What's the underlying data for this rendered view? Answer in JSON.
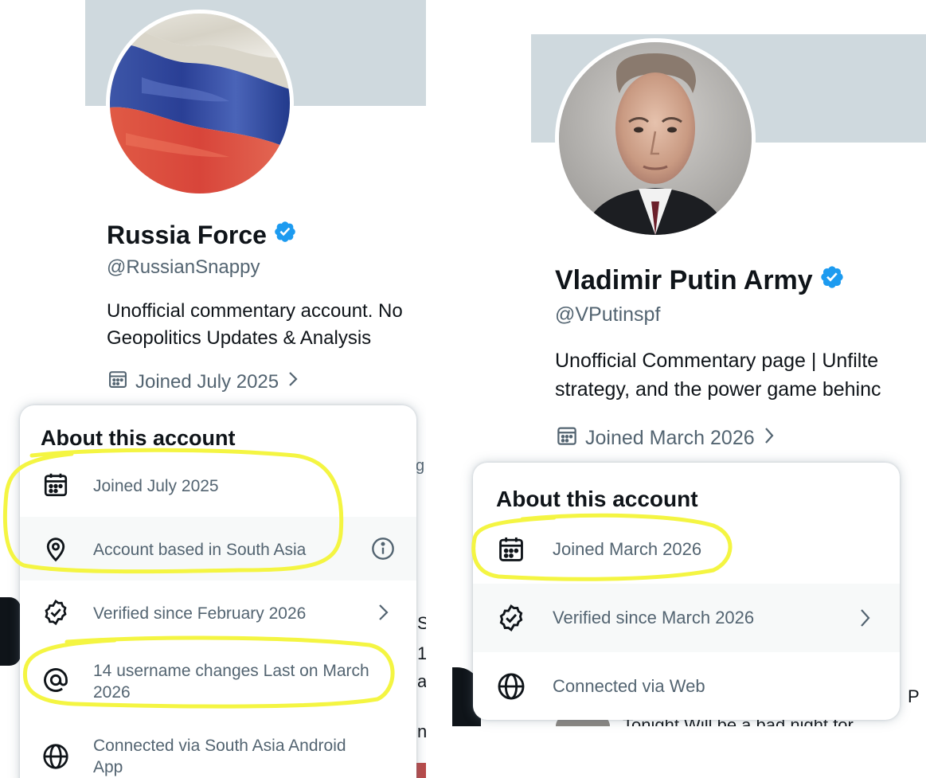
{
  "left": {
    "profile": {
      "display_name": "Russia Force",
      "handle": "@RussianSnappy",
      "bio_line_1": "Unofficial commentary account. No",
      "bio_line_2": "Geopolitics Updates & Analysis",
      "joined": "Joined July 2025",
      "avatar_description": "Russian flag",
      "verified": true
    },
    "about": {
      "title": "About this account",
      "rows": [
        {
          "icon": "calendar-icon",
          "text": "Joined July 2025"
        },
        {
          "icon": "location-pin-icon",
          "text": "Account based in South Asia",
          "trailing": "info-icon"
        },
        {
          "icon": "verified-check-icon",
          "text": "Verified since February 2026",
          "trailing": "chevron-right-icon"
        },
        {
          "icon": "at-sign-icon",
          "text_line_1": "14 username changes Last on March",
          "text_line_2": "2026"
        },
        {
          "icon": "globe-icon",
          "text_line_1": "Connected via South Asia Android",
          "text_line_2": "App"
        }
      ]
    },
    "background_fragments": [
      "g",
      "S",
      "1",
      "a",
      "nl"
    ]
  },
  "right": {
    "profile": {
      "display_name": "Vladimir Putin Army",
      "handle": "@VPutinspf",
      "bio_line_1": "Unofficial Commentary page | Unfilte",
      "bio_line_2": "strategy, and the power game behinc",
      "joined": "Joined March 2026",
      "avatar_description": "portrait photo",
      "verified": true
    },
    "about": {
      "title": "About this account",
      "rows": [
        {
          "icon": "calendar-icon",
          "text": "Joined March 2026"
        },
        {
          "icon": "verified-check-icon",
          "text": "Verified since March 2026",
          "trailing": "chevron-right-icon"
        },
        {
          "icon": "globe-icon",
          "text": "Connected via Web"
        }
      ]
    },
    "background_fragments": [
      "P",
      "Tonight Will be a bad night for"
    ]
  },
  "colors": {
    "banner": "#cfd9de",
    "verified_blue": "#1d9bf0",
    "secondary_text": "#536471",
    "primary_text": "#0f1419",
    "highlight_yellow": "#f4f542",
    "row_hover": "#f7f9f9"
  }
}
